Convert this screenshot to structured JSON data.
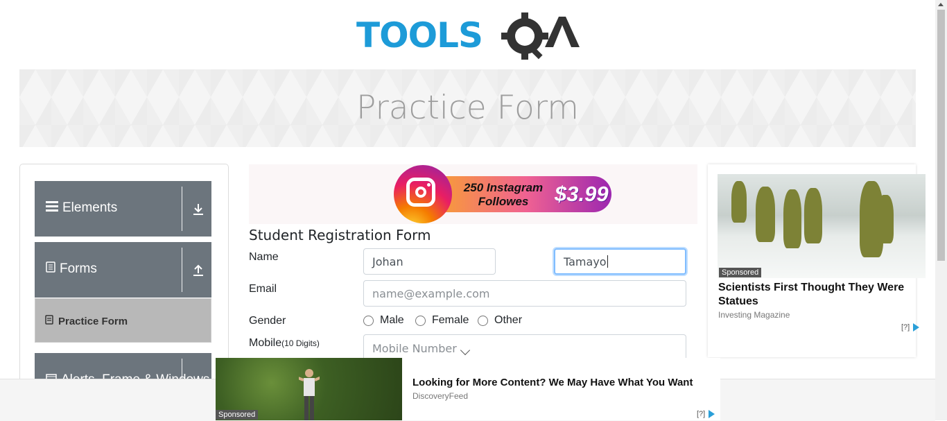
{
  "brand": {
    "logo_text": "TOOLSQA",
    "colors": {
      "tools": "#1d9bd8",
      "qa": "#333333"
    }
  },
  "banner": {
    "title": "Practice Form"
  },
  "sidebar": {
    "groups": [
      {
        "label": "Elements",
        "icon": "hamburger-icon",
        "arrow": "download-arrow-icon"
      },
      {
        "label": "Forms",
        "icon": "document-icon",
        "arrow": "upload-arrow-icon"
      },
      {
        "label": "Alerts, Frame & Windows",
        "icon": "window-icon",
        "arrow": "download-arrow-icon"
      }
    ],
    "active_item": {
      "label": "Practice Form",
      "icon": "list-icon"
    }
  },
  "ad_top": {
    "headline": "250 Instagram Followes",
    "price": "$3.99"
  },
  "form": {
    "title": "Student Registration Form",
    "name_label": "Name",
    "first_name": "Johan",
    "last_name": "Tamayo",
    "email_label": "Email",
    "email_placeholder": "name@example.com",
    "gender_label": "Gender",
    "gender_options": [
      "Male",
      "Female",
      "Other"
    ],
    "mobile_label": "Mobile",
    "mobile_hint": "(10 Digits)",
    "mobile_placeholder": "Mobile Number"
  },
  "ad_right": {
    "sponsored": "Sponsored",
    "headline": "Scientists First Thought They Were Statues",
    "source": "Investing Magazine",
    "adchoice": "[?]"
  },
  "ad_bottom": {
    "sponsored": "Sponsored",
    "headline": "Looking for More Content? We May Have What You Want",
    "source": "DiscoveryFeed",
    "adchoice": "[?]"
  }
}
